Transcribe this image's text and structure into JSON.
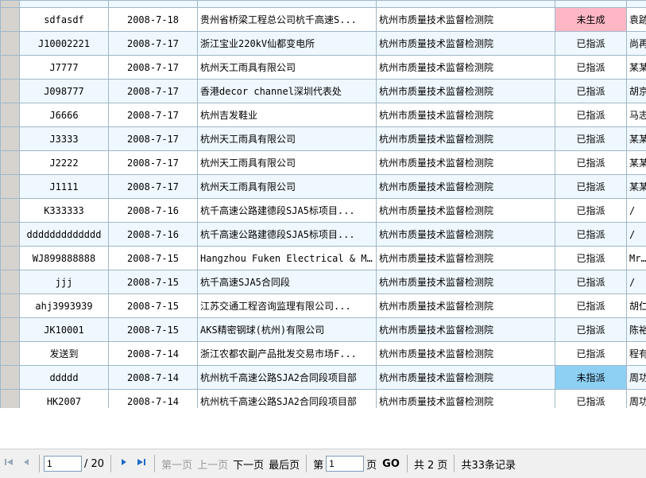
{
  "rows": [
    {
      "code": "sdfasdf",
      "date": "2008-7-18",
      "unit": "贵州省桥梁工程总公司杭千高速S...",
      "org": "杭州市质量技术监督检测院",
      "status": "未生成",
      "status_style": "red",
      "extra": "袁跡"
    },
    {
      "code": "J10002221",
      "date": "2008-7-17",
      "unit": "浙江宝业220kV仙都变电所",
      "org": "杭州市质量技术监督检测院",
      "status": "已指派",
      "status_style": "",
      "extra": "尚再"
    },
    {
      "code": "J7777",
      "date": "2008-7-17",
      "unit": "杭州天工雨具有限公司",
      "org": "杭州市质量技术监督检测院",
      "status": "已指派",
      "status_style": "",
      "extra": "某某"
    },
    {
      "code": "J098777",
      "date": "2008-7-17",
      "unit": "香港decor channel深圳代表处",
      "org": "杭州市质量技术监督检测院",
      "status": "已指派",
      "status_style": "",
      "extra": "胡京"
    },
    {
      "code": "J6666",
      "date": "2008-7-17",
      "unit": "杭州吉发鞋业",
      "org": "杭州市质量技术监督检测院",
      "status": "已指派",
      "status_style": "",
      "extra": "马志"
    },
    {
      "code": "J3333",
      "date": "2008-7-17",
      "unit": "杭州天工雨具有限公司",
      "org": "杭州市质量技术监督检测院",
      "status": "已指派",
      "status_style": "",
      "extra": "某某"
    },
    {
      "code": "J2222",
      "date": "2008-7-17",
      "unit": "杭州天工雨具有限公司",
      "org": "杭州市质量技术监督检测院",
      "status": "已指派",
      "status_style": "",
      "extra": "某某"
    },
    {
      "code": "J1111",
      "date": "2008-7-17",
      "unit": "杭州天工雨具有限公司",
      "org": "杭州市质量技术监督检测院",
      "status": "已指派",
      "status_style": "",
      "extra": "某某"
    },
    {
      "code": "K333333",
      "date": "2008-7-16",
      "unit": "杭千高速公路建德段SJA5标项目...",
      "org": "杭州市质量技术监督检测院",
      "status": "已指派",
      "status_style": "",
      "extra": "/"
    },
    {
      "code": "ddddddddddddd",
      "date": "2008-7-16",
      "unit": "杭千高速公路建德段SJA5标项目...",
      "org": "杭州市质量技术监督检测院",
      "status": "已指派",
      "status_style": "",
      "extra": "/"
    },
    {
      "code": "WJ899888888",
      "date": "2008-7-15",
      "unit": "Hangzhou Fuken Electrical & M...",
      "org": "杭州市质量技术监督检测院",
      "status": "已指派",
      "status_style": "",
      "extra": "Mr.S"
    },
    {
      "code": "jjj",
      "date": "2008-7-15",
      "unit": "杭千高速SJA5合同段",
      "org": "杭州市质量技术监督检测院",
      "status": "已指派",
      "status_style": "",
      "extra": "/"
    },
    {
      "code": "ahj3993939",
      "date": "2008-7-15",
      "unit": "江苏交通工程咨询监理有限公司...",
      "org": "杭州市质量技术监督检测院",
      "status": "已指派",
      "status_style": "",
      "extra": "胡仁"
    },
    {
      "code": "JK10001",
      "date": "2008-7-15",
      "unit": "AKS精密钢球(杭州)有限公司",
      "org": "杭州市质量技术监督检测院",
      "status": "已指派",
      "status_style": "",
      "extra": "陈裕"
    },
    {
      "code": "发送到",
      "date": "2008-7-14",
      "unit": "浙江农都农副产品批发交易市场F...",
      "org": "杭州市质量技术监督检测院",
      "status": "已指派",
      "status_style": "",
      "extra": "程有"
    },
    {
      "code": "ddddd",
      "date": "2008-7-14",
      "unit": "杭州杭千高速公路SJA2合同段项目部",
      "org": "杭州市质量技术监督检测院",
      "status": "未指派",
      "status_style": "blue",
      "extra": "周功"
    },
    {
      "code": "HK2007",
      "date": "2008-7-14",
      "unit": "杭州杭千高速公路SJA2合同段项目部",
      "org": "杭州市质量技术监督检测院",
      "status": "已指派",
      "status_style": "",
      "extra": "周功"
    }
  ],
  "pager": {
    "current_page_value": "1",
    "total_pages_label": "/ 20",
    "first_page": "第一页",
    "prev_page": "上一页",
    "next_page": "下一页",
    "last_page": "最后页",
    "jump_prefix": "第",
    "jump_value": "1",
    "jump_suffix": "页",
    "go_label": "GO",
    "pages_summary": "共 2 页",
    "records_summary": "共33条记录",
    "icons": {
      "first": "first-page-icon",
      "prev": "prev-page-icon",
      "next": "next-page-icon",
      "last": "last-page-icon"
    }
  },
  "colors": {
    "status_red": "#ffb7c5",
    "status_blue": "#8ed0f4",
    "row_alt": "#eff8ff",
    "grid_border": "#9fb7c9"
  }
}
